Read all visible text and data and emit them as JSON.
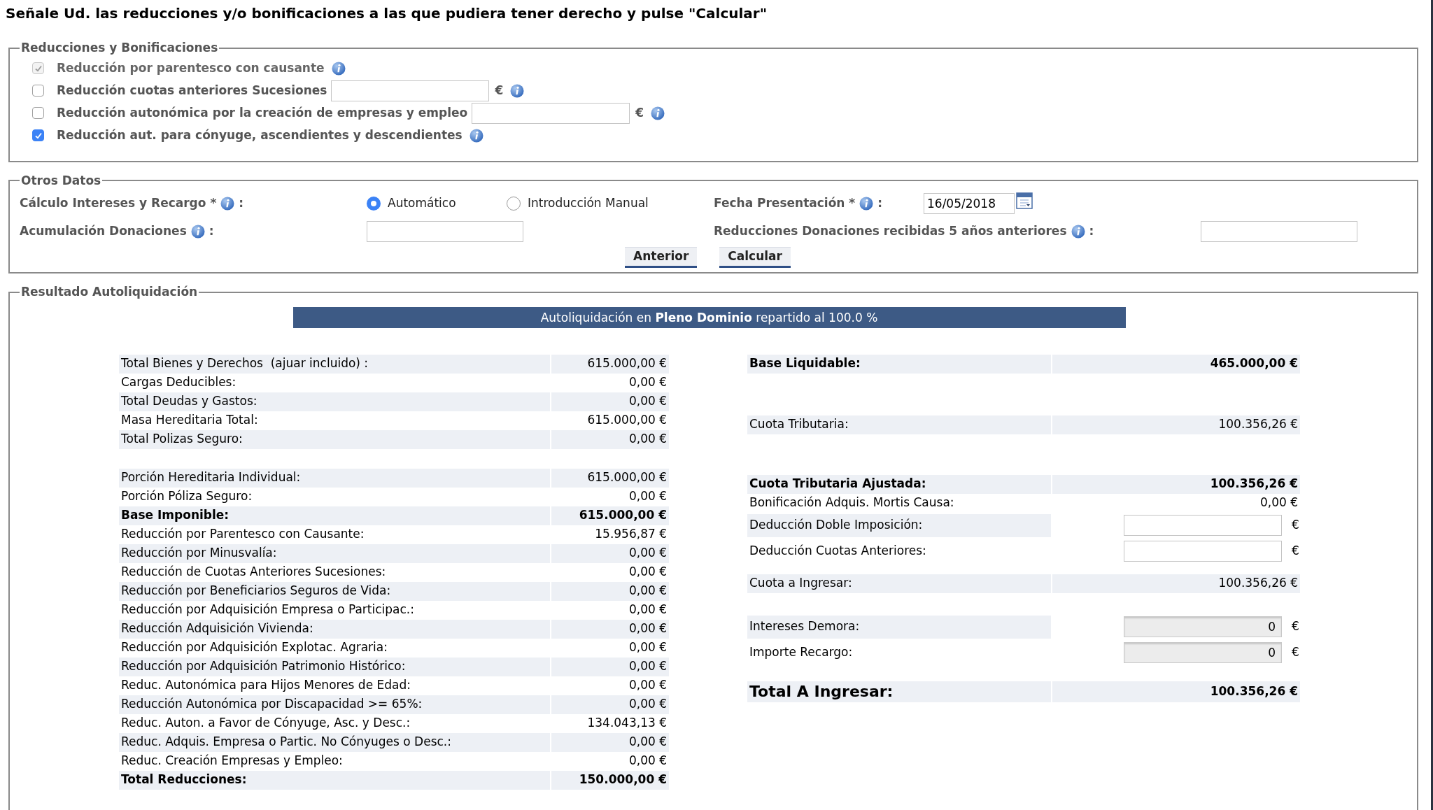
{
  "heading": "Señale Ud. las reducciones y/o bonificaciones a las que pudiera tener derecho y pulse \"Calcular\"",
  "reducciones": {
    "legend": "Reducciones y Bonificaciones",
    "items": [
      {
        "kind": "check",
        "label": "Reducción por parentesco con causante",
        "checked": true,
        "disabled": true
      },
      {
        "kind": "amount",
        "label": "Reducción cuotas anteriores Sucesiones",
        "checked": false,
        "disabled": false,
        "currency": "€"
      },
      {
        "kind": "amount",
        "label": "Reducción autonómica por la creación de empresas y empleo",
        "checked": false,
        "disabled": false,
        "currency": "€"
      },
      {
        "kind": "check",
        "label": "Reducción aut. para cónyuge, ascendientes y descendientes",
        "checked": true,
        "disabled": false
      }
    ]
  },
  "otros_datos": {
    "legend": "Otros Datos",
    "calculo": {
      "label": "Cálculo Intereses y Recargo *",
      "suffix": ":",
      "options": [
        {
          "label": "Automático",
          "selected": true
        },
        {
          "label": "Introducción Manual",
          "selected": false
        }
      ]
    },
    "fecha": {
      "label": "Fecha Presentación *",
      "suffix": ":",
      "value": "16/05/2018"
    },
    "acumulacion": {
      "label": "Acumulación Donaciones",
      "suffix": ":"
    },
    "donaciones_anteriores": {
      "label": "Reducciones Donaciones recibidas 5 años anteriores",
      "suffix": ":"
    },
    "buttons": [
      "Anterior",
      "Calcular"
    ]
  },
  "resultado": {
    "legend": "Resultado Autoliquidación",
    "banner": "Autoliquidación en **Pleno Dominio** repartido al 100.0 %",
    "left_groups": [
      {
        "rows": [
          {
            "label": "Total Bienes y Derechos  (ajuar incluido) :",
            "value": "615.000,00 €",
            "bold": false,
            "shaded": true
          },
          {
            "label": "Cargas Deducibles:",
            "value": "0,00 €",
            "bold": false,
            "shaded": false
          },
          {
            "label": "Total Deudas y Gastos:",
            "value": "0,00 €",
            "bold": false,
            "shaded": true
          },
          {
            "label": "Masa Hereditaria Total:",
            "value": "615.000,00 €",
            "bold": false,
            "shaded": false
          },
          {
            "label": "Total Polizas Seguro:",
            "value": "0,00 €",
            "bold": false,
            "shaded": true
          }
        ]
      },
      {
        "rows": [
          {
            "label": "Porción Hereditaria Individual:",
            "value": "615.000,00 €",
            "bold": false,
            "shaded": true
          },
          {
            "label": "Porción Póliza Seguro:",
            "value": "0,00 €",
            "bold": false,
            "shaded": false
          },
          {
            "label": "Base Imponible:",
            "value": "615.000,00 €",
            "bold": true,
            "shaded": true
          },
          {
            "label": "Reducción por Parentesco con Causante:",
            "value": "15.956,87 €",
            "bold": false,
            "shaded": false
          },
          {
            "label": "Reducción por Minusvalía:",
            "value": "0,00 €",
            "bold": false,
            "shaded": true
          },
          {
            "label": "Reducción de Cuotas Anteriores Sucesiones:",
            "value": "0,00 €",
            "bold": false,
            "shaded": false
          },
          {
            "label": "Reducción por Beneficiarios Seguros de Vida:",
            "value": "0,00 €",
            "bold": false,
            "shaded": true
          },
          {
            "label": "Reducción por Adquisición Empresa o Participac.:",
            "value": "0,00 €",
            "bold": false,
            "shaded": false
          },
          {
            "label": "Reducción Adquisición Vivienda:",
            "value": "0,00 €",
            "bold": false,
            "shaded": true
          },
          {
            "label": "Reducción por Adquisición Explotac. Agraria:",
            "value": "0,00 €",
            "bold": false,
            "shaded": false
          },
          {
            "label": "Reducción por Adquisición Patrimonio Histórico:",
            "value": "0,00 €",
            "bold": false,
            "shaded": true
          },
          {
            "label": "Reduc. Autonómica para Hijos Menores de Edad:",
            "value": "0,00 €",
            "bold": false,
            "shaded": false
          },
          {
            "label": "Reducción Autonómica por Discapacidad >= 65%:",
            "value": "0,00 €",
            "bold": false,
            "shaded": true
          },
          {
            "label": "Reduc. Auton. a Favor de Cónyuge, Asc. y Desc.:",
            "value": "134.043,13 €",
            "bold": false,
            "shaded": false
          },
          {
            "label": "Reduc. Adquis. Empresa o Partic. No Cónyuges o Desc.:",
            "value": "0,00 €",
            "bold": false,
            "shaded": true
          },
          {
            "label": "Reduc. Creación Empresas y Empleo:",
            "value": "0,00 €",
            "bold": false,
            "shaded": false
          },
          {
            "label": "Total Reducciones:",
            "value": "150.000,00 €",
            "bold": true,
            "shaded": true
          }
        ]
      }
    ],
    "right_groups": [
      {
        "rows": [
          {
            "kind": "value",
            "label": "Base Liquidable:",
            "value": "465.000,00 €",
            "bold": true,
            "shaded": true
          }
        ]
      },
      {
        "rows": [
          {
            "kind": "value",
            "label": "Cuota Tributaria:",
            "value": "100.356,26 €",
            "bold": false,
            "shaded": true
          }
        ]
      },
      {
        "rows": [
          {
            "kind": "value",
            "label": "Cuota Tributaria Ajustada:",
            "value": "100.356,26 €",
            "bold": true,
            "shaded": true
          },
          {
            "kind": "value",
            "label": "Bonificación Adquis. Mortis Causa:",
            "value": "0,00 €",
            "bold": false,
            "shaded": false
          },
          {
            "kind": "input",
            "label": "Deducción Doble Imposición:",
            "unit": "€",
            "disabled": false,
            "bold": false,
            "shaded": true
          },
          {
            "kind": "input",
            "label": "Deducción Cuotas Anteriores:",
            "unit": "€",
            "disabled": false,
            "bold": false,
            "shaded": false
          }
        ]
      },
      {
        "rows": [
          {
            "kind": "value",
            "label": "Cuota a Ingresar:",
            "value": "100.356,26 €",
            "bold": false,
            "shaded": true
          }
        ]
      },
      {
        "rows": [
          {
            "kind": "input",
            "label": "Intereses Demora:",
            "value": "0",
            "unit": "€",
            "disabled": true,
            "bold": false,
            "shaded": true
          },
          {
            "kind": "input",
            "label": "Importe Recargo:",
            "value": "0",
            "unit": "€",
            "disabled": true,
            "bold": false,
            "shaded": false
          }
        ]
      },
      {
        "rows": [
          {
            "kind": "total",
            "label": "Total A Ingresar:",
            "value": "100.356,26 €",
            "bold": true,
            "shaded": true
          }
        ]
      }
    ]
  }
}
